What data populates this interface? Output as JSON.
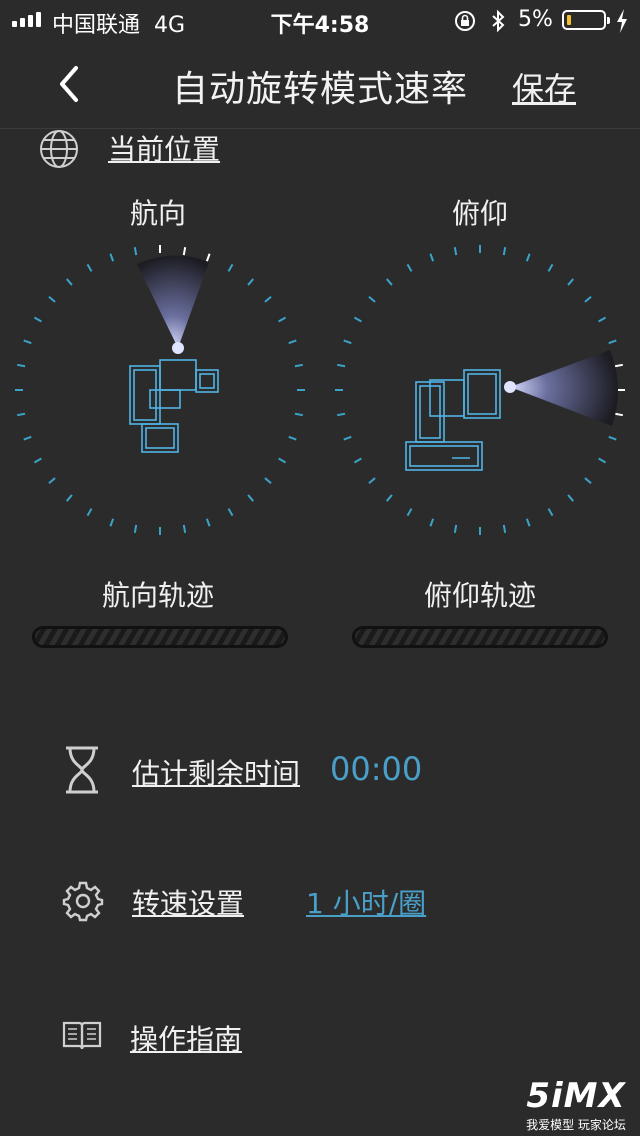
{
  "status_bar": {
    "carrier": "中国联通",
    "network": "4G",
    "time": "下午4:58",
    "battery_percent": "5%",
    "battery_level": 0.05,
    "battery_color": "#f2c230"
  },
  "nav": {
    "back_icon": "chevron-left-icon",
    "title": "自动旋转模式速率",
    "save_label": "保存"
  },
  "location": {
    "icon": "globe-icon",
    "label": "当前位置"
  },
  "dials": [
    {
      "title": "航向",
      "track_label": "航向轨迹",
      "beam": "up"
    },
    {
      "title": "俯仰",
      "track_label": "俯仰轨迹",
      "beam": "right"
    }
  ],
  "remaining_time": {
    "icon": "hourglass-icon",
    "label": "估计剩余时间",
    "value": "00:00"
  },
  "speed_setting": {
    "icon": "gear-icon",
    "label": "转速设置",
    "value": "1 小时/圈"
  },
  "guide": {
    "icon": "book-icon",
    "label": "操作指南"
  },
  "watermark": {
    "logo": "5iMX",
    "caption": "我爱模型 玩家论坛"
  },
  "colors": {
    "background": "#2b2b2c",
    "accent": "#4a9fc9",
    "tick": "#3aa3c8",
    "device_outline": "#4fb3e6"
  }
}
